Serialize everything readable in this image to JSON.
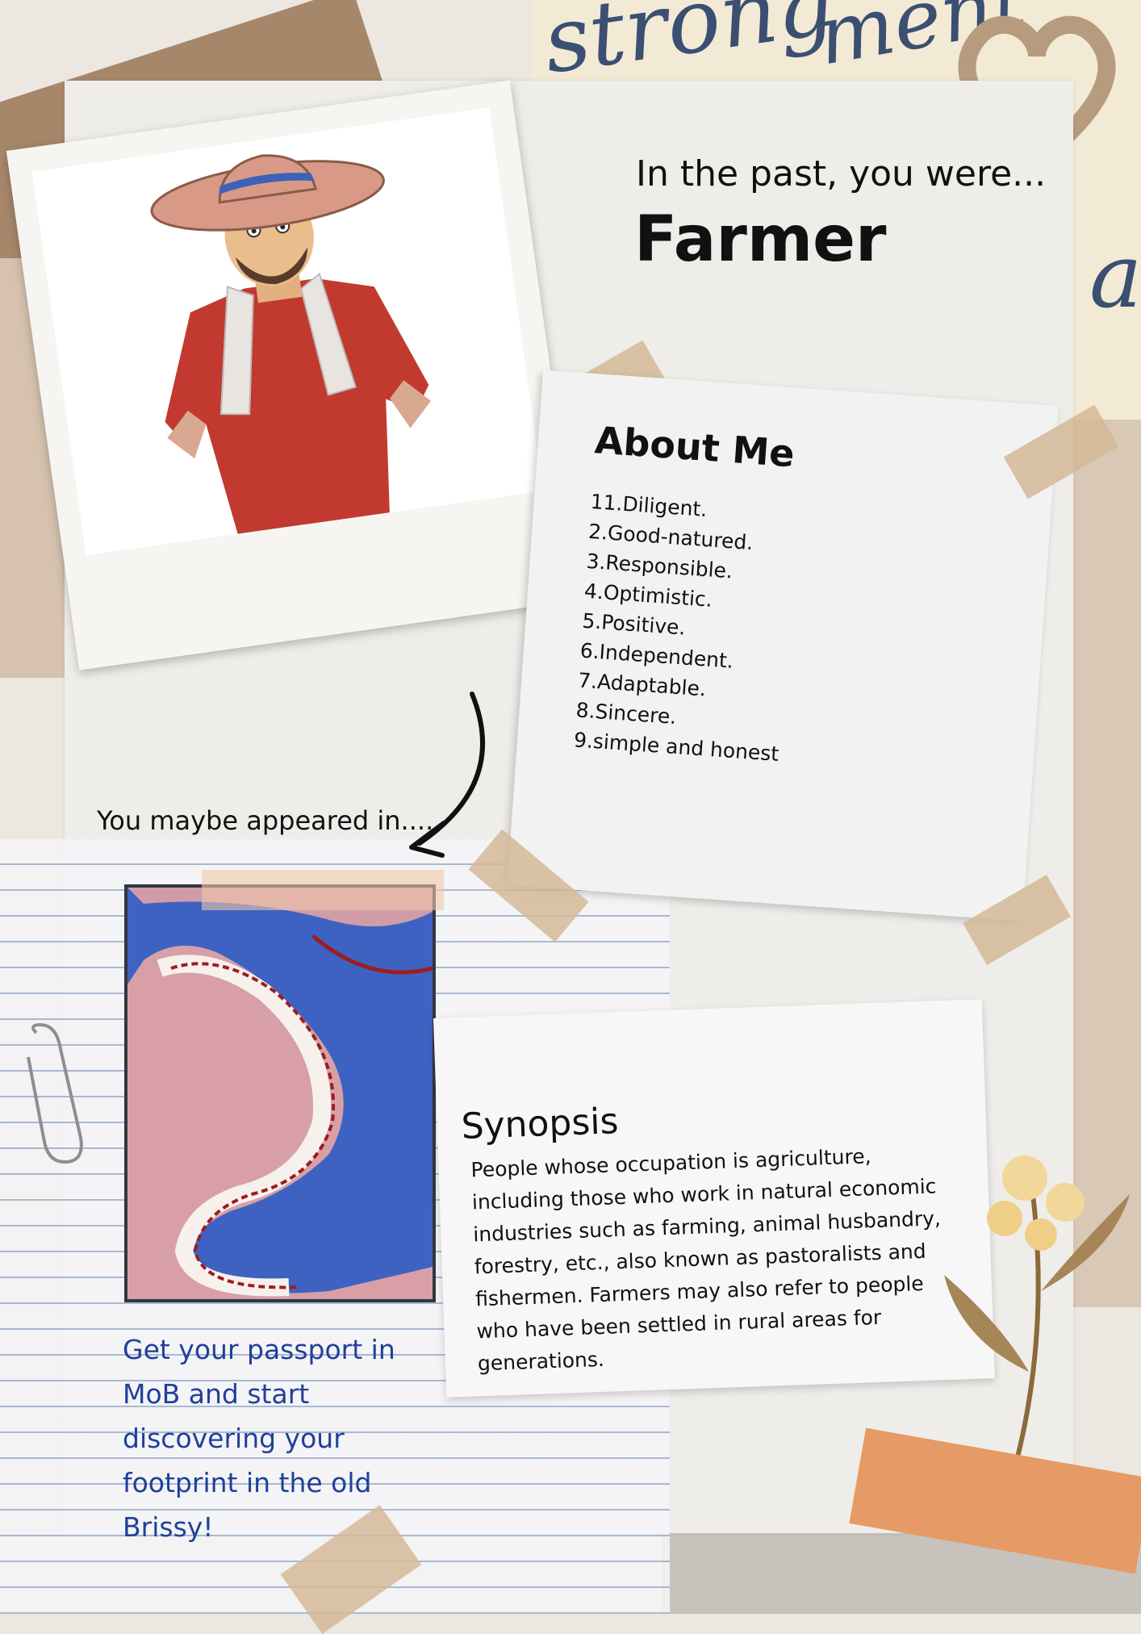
{
  "header": {
    "intro": "In the past, you were...",
    "role": "Farmer"
  },
  "about": {
    "title": "About Me",
    "items": [
      "11.Diligent.",
      "2.Good-natured.",
      "3.Responsible.",
      "4.Optimistic.",
      "5.Positive.",
      "6.Independent.",
      "7.Adaptable.",
      "8.Sincere.",
      "9.simple and honest"
    ]
  },
  "appeared": {
    "label": "You maybe appeared in...."
  },
  "synopsis": {
    "title": "Synopsis",
    "text": "People whose occupation is agriculture, including those who work in natural economic industries such as farming, animal husbandry, forestry, etc., also known as pastoralists and fishermen. Farmers may also refer to people who have been settled in rural areas for generations."
  },
  "cta": {
    "text": "Get  your passport in MoB and start discovering your footprint in the old Brissy!"
  },
  "colors": {
    "cta": "#1f3f9a",
    "map_water": "#3e62c2",
    "map_land": "#e9a7a3",
    "map_edge": "#9d1d1d",
    "tape": "#d4b896"
  },
  "icons": [
    "paperclip-icon",
    "arrow-icon",
    "heart-icon",
    "flower-icon"
  ]
}
